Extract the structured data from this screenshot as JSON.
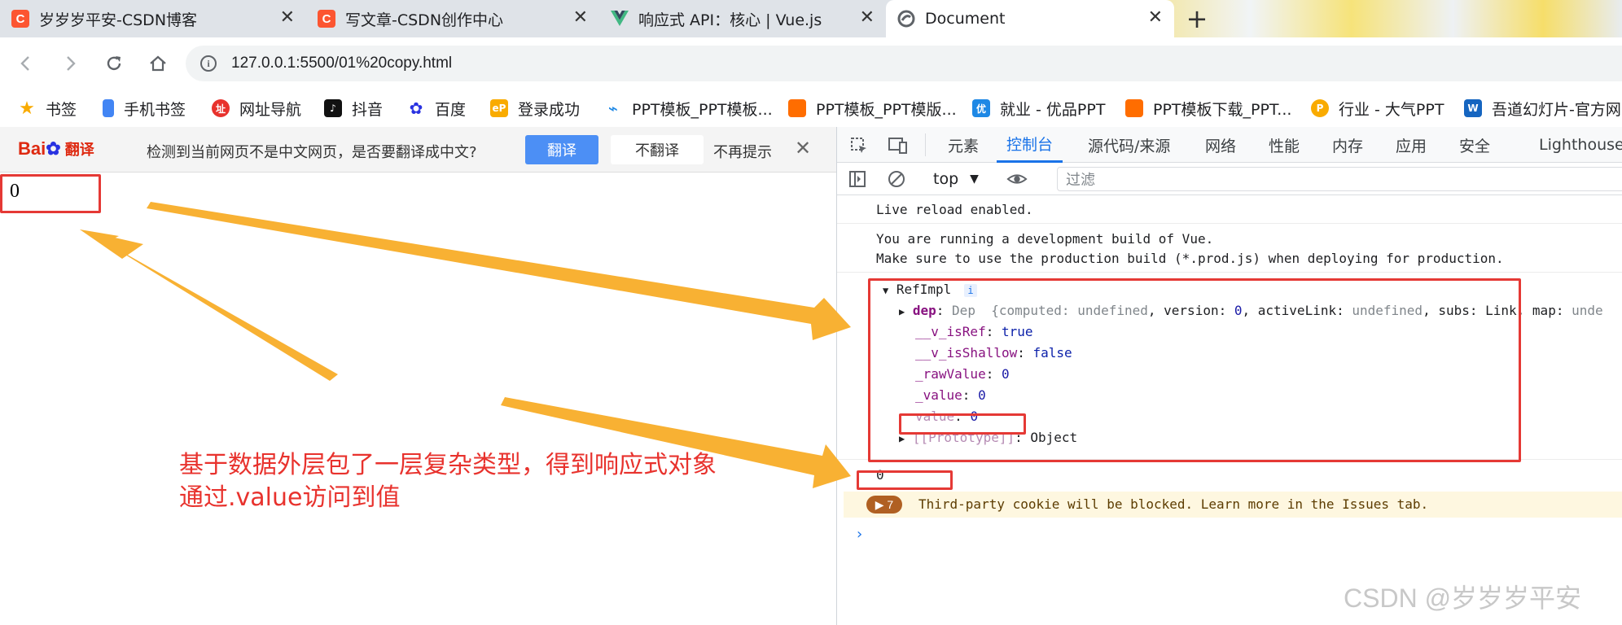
{
  "tabs": [
    {
      "title": "岁岁岁平安-CSDN博客",
      "icon": "csdn-icon",
      "active": false
    },
    {
      "title": "写文章-CSDN创作中心",
      "icon": "csdn-icon",
      "active": false
    },
    {
      "title": "响应式 API：核心 | Vue.js",
      "icon": "vue-icon",
      "active": false
    },
    {
      "title": "Document",
      "icon": "document-icon",
      "active": true
    }
  ],
  "address": {
    "url": "127.0.0.1:5500/01%20copy.html"
  },
  "bookmarks": [
    {
      "label": "书签",
      "icon": "star-icon",
      "color": "#f9ab00"
    },
    {
      "label": "手机书签",
      "icon": "phone-icon",
      "color": "#4285f4"
    },
    {
      "label": "网址导航",
      "icon": "hao123-icon",
      "color": "#e8322d"
    },
    {
      "label": "抖音",
      "icon": "douyin-icon",
      "color": "#111111"
    },
    {
      "label": "百度",
      "icon": "baidu-paw-icon",
      "color": "#2932e1"
    },
    {
      "label": "登录成功",
      "icon": "ep-icon",
      "color": "#f9ab00"
    },
    {
      "label": "PPT模板_PPT模板...",
      "icon": "ppt-icon-blue",
      "color": "#1e88e5"
    },
    {
      "label": "PPT模板_PPT模版...",
      "icon": "ppt-icon-orange",
      "color": "#ff6d00"
    },
    {
      "label": "就业 - 优品PPT",
      "icon": "youpin-icon",
      "color": "#1e88e5"
    },
    {
      "label": "PPT模板下载_PPT...",
      "icon": "ppt-icon-orange",
      "color": "#ff6d00"
    },
    {
      "label": "行业 - 大气PPT",
      "icon": "daqi-icon",
      "color": "#f9ab00"
    },
    {
      "label": "吾道幻灯片-官方网...",
      "icon": "wudao-icon",
      "color": "#1565c0"
    }
  ],
  "translate_bar": {
    "logo": "Bai翻译",
    "message": "检测到当前网页不是中文网页，是否要翻译成中文?",
    "translate_btn": "翻译",
    "no_translate_btn": "不翻译",
    "never_show": "不再提示"
  },
  "page": {
    "value": "0",
    "annotation_line1": "基于数据外层包了一层复杂类型，得到响应式对象",
    "annotation_line2": "通过.value访问到值"
  },
  "devtools": {
    "tabs": [
      "元素",
      "控制台",
      "源代码/来源",
      "网络",
      "性能",
      "内存",
      "应用",
      "安全",
      "Lighthouse"
    ],
    "active_tab": "控制台",
    "context": "top",
    "filter_placeholder": "过滤",
    "console": {
      "live_reload": "Live reload enabled.",
      "vue_dev_1": "You are running a development build of Vue.",
      "vue_dev_2": "Make sure to use the production build (*.prod.js) when deploying for production.",
      "refimpl": "RefImpl",
      "info_badge": "i",
      "dep_key": "dep",
      "dep_type": "Dep",
      "dep_preview_open": "{computed: ",
      "dep_undef1": "undefined",
      "dep_mid1": ", version: ",
      "dep_version": "0",
      "dep_mid2": ", activeLink: ",
      "dep_undef2": "undefined",
      "dep_mid3": ", subs: Link, map: ",
      "dep_undef3": "unde",
      "v_isRef_key": "__v_isRef",
      "v_isRef_val": "true",
      "v_isShallow_key": "__v_isShallow",
      "v_isShallow_val": "false",
      "rawValue_key": "_rawValue",
      "rawValue_val": "0",
      "value_key": "_value",
      "value_val": "0",
      "getter_key": "value",
      "getter_val": "0",
      "proto_key": "[[Prototype]]",
      "proto_val": "Object",
      "log_value": "0",
      "warn_count": "7",
      "warn_text": "Third-party cookie will be blocked. Learn more in the Issues tab."
    }
  },
  "watermark": "CSDN @岁岁岁平安",
  "colors": {
    "accent": "#1a73e8",
    "annotation": "#e8322d",
    "arrow": "#f8b133",
    "box": "#e53935"
  }
}
